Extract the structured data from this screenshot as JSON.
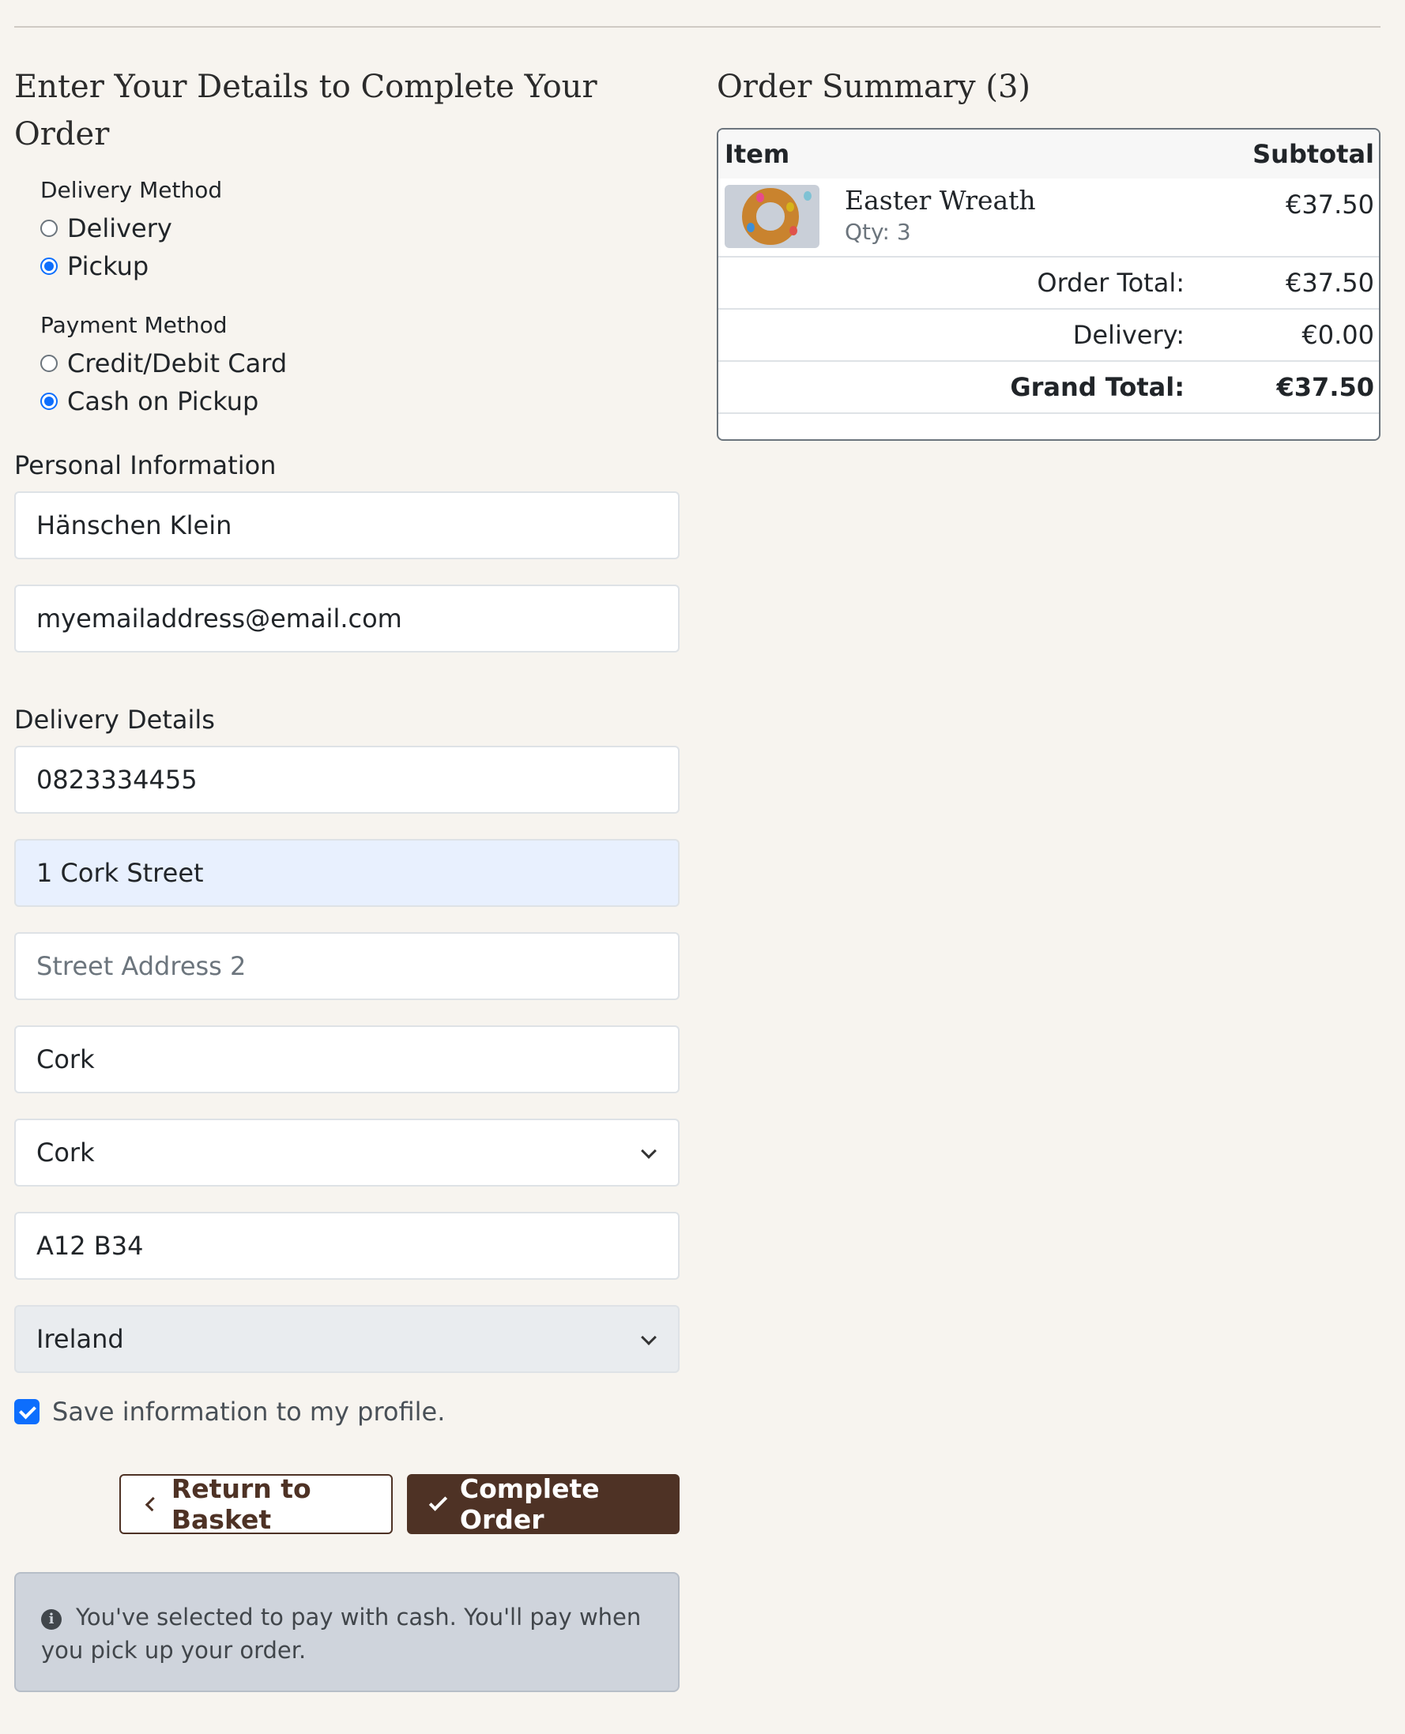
{
  "form": {
    "title": "Enter Your Details to Complete Your Order",
    "delivery_method": {
      "label": "Delivery Method",
      "options": [
        "Delivery",
        "Pickup"
      ],
      "selected": "Pickup"
    },
    "payment_method": {
      "label": "Payment Method",
      "options": [
        "Credit/Debit Card",
        "Cash on Pickup"
      ],
      "selected": "Cash on Pickup"
    },
    "personal": {
      "label": "Personal Information",
      "name_value": "Hänschen Klein",
      "email_value": "myemailaddress@email.com"
    },
    "delivery": {
      "label": "Delivery Details",
      "phone_value": "0823334455",
      "street1_value": "1 Cork Street",
      "street2_placeholder": "Street Address 2",
      "city_value": "Cork",
      "county_selected": "Cork",
      "postcode_value": "A12 B34",
      "country_selected": "Ireland"
    },
    "save_profile_label": "Save information to my profile.",
    "save_profile_checked": true,
    "return_button": "Return to Basket",
    "complete_button": "Complete Order",
    "alert_text": "You've selected to pay with cash. You'll pay when you pick up your order."
  },
  "summary": {
    "title": "Order Summary (3)",
    "col_item": "Item",
    "col_subtotal": "Subtotal",
    "items": [
      {
        "name": "Easter Wreath",
        "qty": "Qty: 3",
        "subtotal": "€37.50"
      }
    ],
    "order_total_label": "Order Total:",
    "order_total_value": "€37.50",
    "delivery_label": "Delivery:",
    "delivery_value": "€0.00",
    "grand_total_label": "Grand Total:",
    "grand_total_value": "€37.50"
  },
  "colors": {
    "accent_brown": "#4e3225",
    "primary_blue": "#0d6efd",
    "page_background": "#f7f4ef"
  }
}
